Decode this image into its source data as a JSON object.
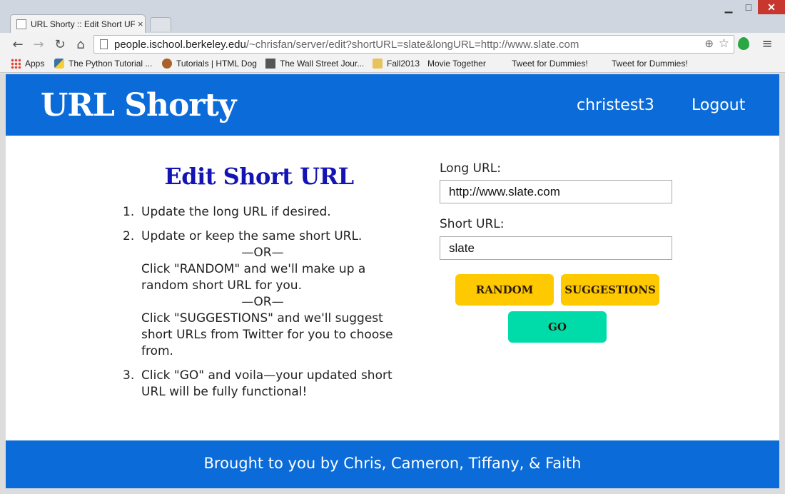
{
  "browser": {
    "tab_title": "URL Shorty :: Edit Short UF",
    "url_host": "people.ischool.berkeley.edu",
    "url_path": "/~chrisfan/server/edit?shortURL=slate&longURL=http://www.slate.com",
    "bookmarks": [
      {
        "label": "Apps",
        "icon": "apps-icon"
      },
      {
        "label": "The Python Tutorial ...",
        "icon": "python-icon"
      },
      {
        "label": "Tutorials | HTML Dog",
        "icon": "dog-icon"
      },
      {
        "label": "The Wall Street Jour...",
        "icon": "wsj-icon"
      },
      {
        "label": "Fall2013",
        "icon": "folder-icon"
      },
      {
        "label": "Movie Together",
        "icon": "page-icon"
      },
      {
        "label": "Tweet for Dummies!",
        "icon": "page-icon"
      },
      {
        "label": "Tweet for Dummies!",
        "icon": "page-icon"
      }
    ]
  },
  "header": {
    "brand": "URL Shorty",
    "username": "christest3",
    "logout": "Logout"
  },
  "main": {
    "title": "Edit Short URL",
    "steps": {
      "s1": "Update the long URL if desired.",
      "s2a": "Update or keep the same short URL.",
      "or": "—OR—",
      "s2b": "Click \"RANDOM\" and we'll make up a random short URL for you.",
      "s2c": "Click \"SUGGESTIONS\" and we'll suggest short URLs from Twitter for you to choose from.",
      "s3": "Click \"GO\" and voila—your updated short URL will be fully functional!"
    }
  },
  "form": {
    "long_label": "Long URL:",
    "long_value": "http://www.slate.com",
    "short_label": "Short URL:",
    "short_value": "slate",
    "random_label": "RANDOM",
    "suggestions_label": "SUGGESTIONS",
    "go_label": "GO"
  },
  "footer": {
    "text": "Brought to you by Chris, Cameron, Tiffany, & Faith"
  },
  "colors": {
    "header_blue": "#0b6bd8",
    "title_blue": "#1414b4",
    "button_yellow": "#ffc900",
    "button_green": "#00dbaa"
  }
}
